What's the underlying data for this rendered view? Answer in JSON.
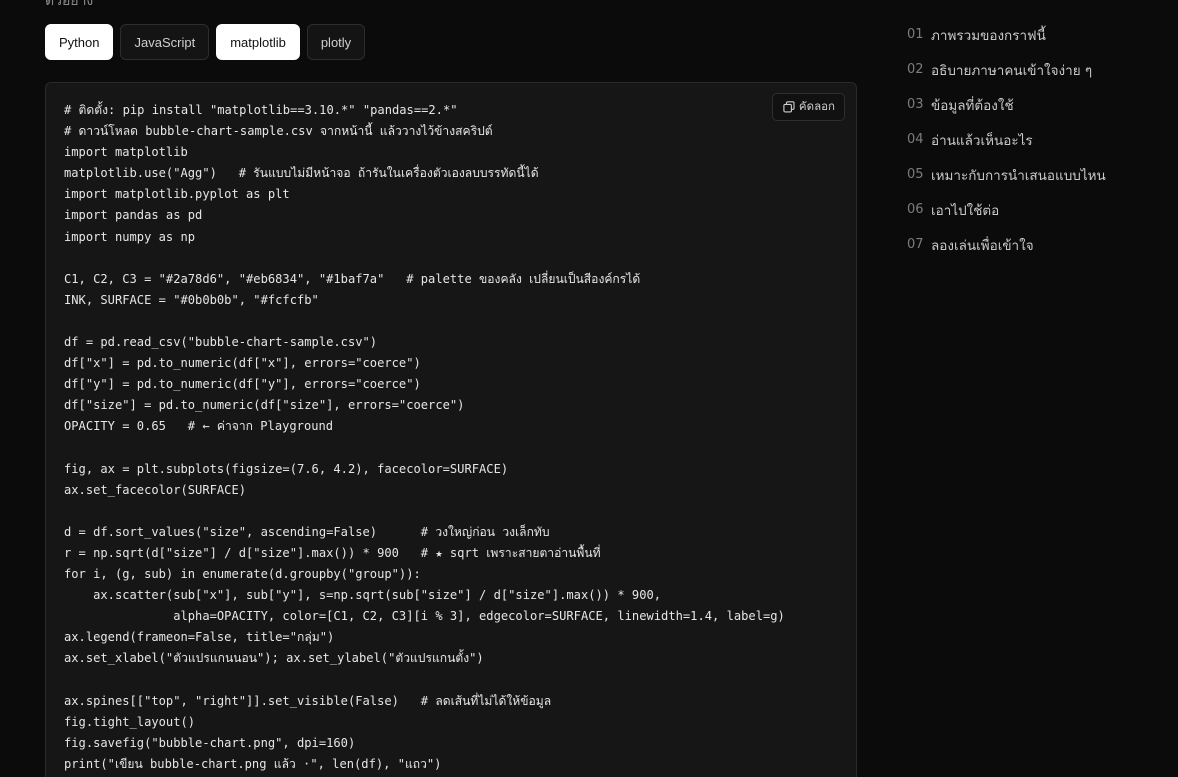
{
  "header": {
    "clipped_title": "ตัวอย่าง"
  },
  "tabs": [
    {
      "label": "Python",
      "active": true
    },
    {
      "label": "JavaScript",
      "active": false
    },
    {
      "label": "matplotlib",
      "active": true
    },
    {
      "label": "plotly",
      "active": false
    }
  ],
  "code_panel": {
    "copy_label": "คัดลอก",
    "copy_icon": "copy-icon",
    "lines": [
      "# ติดตั้ง: pip install \"matplotlib==3.10.*\" \"pandas==2.*\"",
      "# ดาวน์โหลด bubble-chart-sample.csv จากหน้านี้ แล้ววางไว้ข้างสคริปต์",
      "import matplotlib",
      "matplotlib.use(\"Agg\")   # รันแบบไม่มีหน้าจอ ถ้ารันในเครื่องตัวเองลบบรรทัดนี้ได้",
      "import matplotlib.pyplot as plt",
      "import pandas as pd",
      "import numpy as np",
      "",
      "C1, C2, C3 = \"#2a78d6\", \"#eb6834\", \"#1baf7a\"   # palette ของคลัง เปลี่ยนเป็นสีองค์กรได้",
      "INK, SURFACE = \"#0b0b0b\", \"#fcfcfb\"",
      "",
      "df = pd.read_csv(\"bubble-chart-sample.csv\")",
      "df[\"x\"] = pd.to_numeric(df[\"x\"], errors=\"coerce\")",
      "df[\"y\"] = pd.to_numeric(df[\"y\"], errors=\"coerce\")",
      "df[\"size\"] = pd.to_numeric(df[\"size\"], errors=\"coerce\")",
      "OPACITY = 0.65   # ← ค่าจาก Playground",
      "",
      "fig, ax = plt.subplots(figsize=(7.6, 4.2), facecolor=SURFACE)",
      "ax.set_facecolor(SURFACE)",
      "",
      "d = df.sort_values(\"size\", ascending=False)      # วงใหญ่ก่อน วงเล็กทับ",
      "r = np.sqrt(d[\"size\"] / d[\"size\"].max()) * 900   # ★ sqrt เพราะสายตาอ่านพื้นที่",
      "for i, (g, sub) in enumerate(d.groupby(\"group\")):",
      "    ax.scatter(sub[\"x\"], sub[\"y\"], s=np.sqrt(sub[\"size\"] / d[\"size\"].max()) * 900,",
      "               alpha=OPACITY, color=[C1, C2, C3][i % 3], edgecolor=SURFACE, linewidth=1.4, label=g)",
      "ax.legend(frameon=False, title=\"กลุ่ม\")",
      "ax.set_xlabel(\"ตัวแปรแกนนอน\"); ax.set_ylabel(\"ตัวแปรแกนตั้ง\")",
      "",
      "ax.spines[[\"top\", \"right\"]].set_visible(False)   # ลดเส้นที่ไม่ได้ให้ข้อมูล",
      "fig.tight_layout()",
      "fig.savefig(\"bubble-chart.png\", dpi=160)",
      "print(\"เขียน bubble-chart.png แล้ว ·\", len(df), \"แถว\")"
    ]
  },
  "toc": [
    {
      "num": "01",
      "label": "ภาพรวมของกราฟนี้"
    },
    {
      "num": "02",
      "label": "อธิบายภาษาคนเข้าใจง่าย ๆ"
    },
    {
      "num": "03",
      "label": "ข้อมูลที่ต้องใช้"
    },
    {
      "num": "04",
      "label": "อ่านแล้วเห็นอะไร"
    },
    {
      "num": "05",
      "label": "เหมาะกับการนำเสนอแบบไหน"
    },
    {
      "num": "06",
      "label": "เอาไปใช้ต่อ"
    },
    {
      "num": "07",
      "label": "ลองเล่นเพื่อเข้าใจ"
    }
  ]
}
